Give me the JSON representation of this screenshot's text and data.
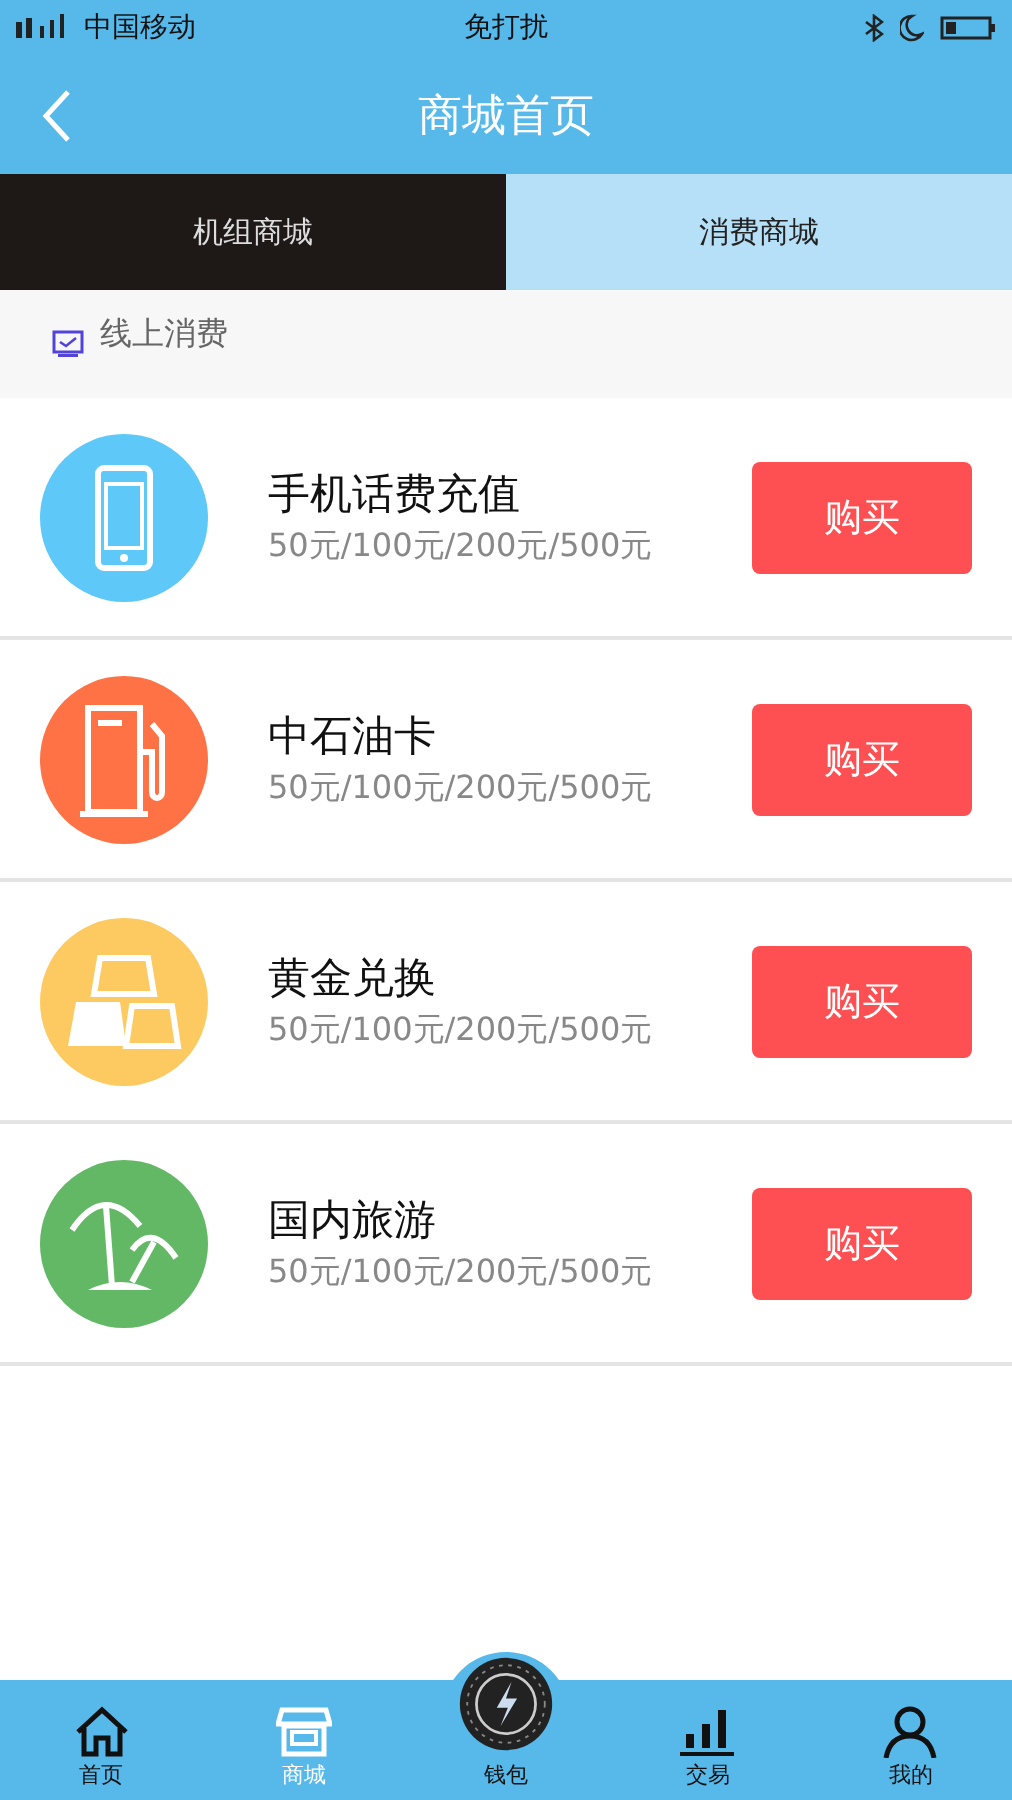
{
  "status_bar": {
    "carrier": "中国移动",
    "center": "免打扰"
  },
  "header": {
    "title": "商城首页"
  },
  "tabs": [
    {
      "label": "机组商城",
      "selected": false
    },
    {
      "label": "消费商城",
      "selected": true
    }
  ],
  "section": {
    "title": "线上消费"
  },
  "products": [
    {
      "kind": "phone",
      "color": "#5ec8f8",
      "name": "手机话费充值",
      "prices": "50元/100元/200元/500元",
      "button": "购买"
    },
    {
      "kind": "fuel",
      "color": "#fe7245",
      "name": "中石油卡",
      "prices": "50元/100元/200元/500元",
      "button": "购买"
    },
    {
      "kind": "gold",
      "color": "#fdca62",
      "name": "黄金兑换",
      "prices": "50元/100元/200元/500元",
      "button": "购买"
    },
    {
      "kind": "travel",
      "color": "#62b865",
      "name": "国内旅游",
      "prices": "50元/100元/200元/500元",
      "button": "购买"
    }
  ],
  "bottom_nav": [
    {
      "kind": "home",
      "label": "首页",
      "selected": false
    },
    {
      "kind": "shop",
      "label": "商城",
      "selected": true
    },
    {
      "kind": "wallet",
      "label": "钱包",
      "selected": false
    },
    {
      "kind": "chart",
      "label": "交易",
      "selected": false
    },
    {
      "kind": "user",
      "label": "我的",
      "selected": false
    }
  ]
}
